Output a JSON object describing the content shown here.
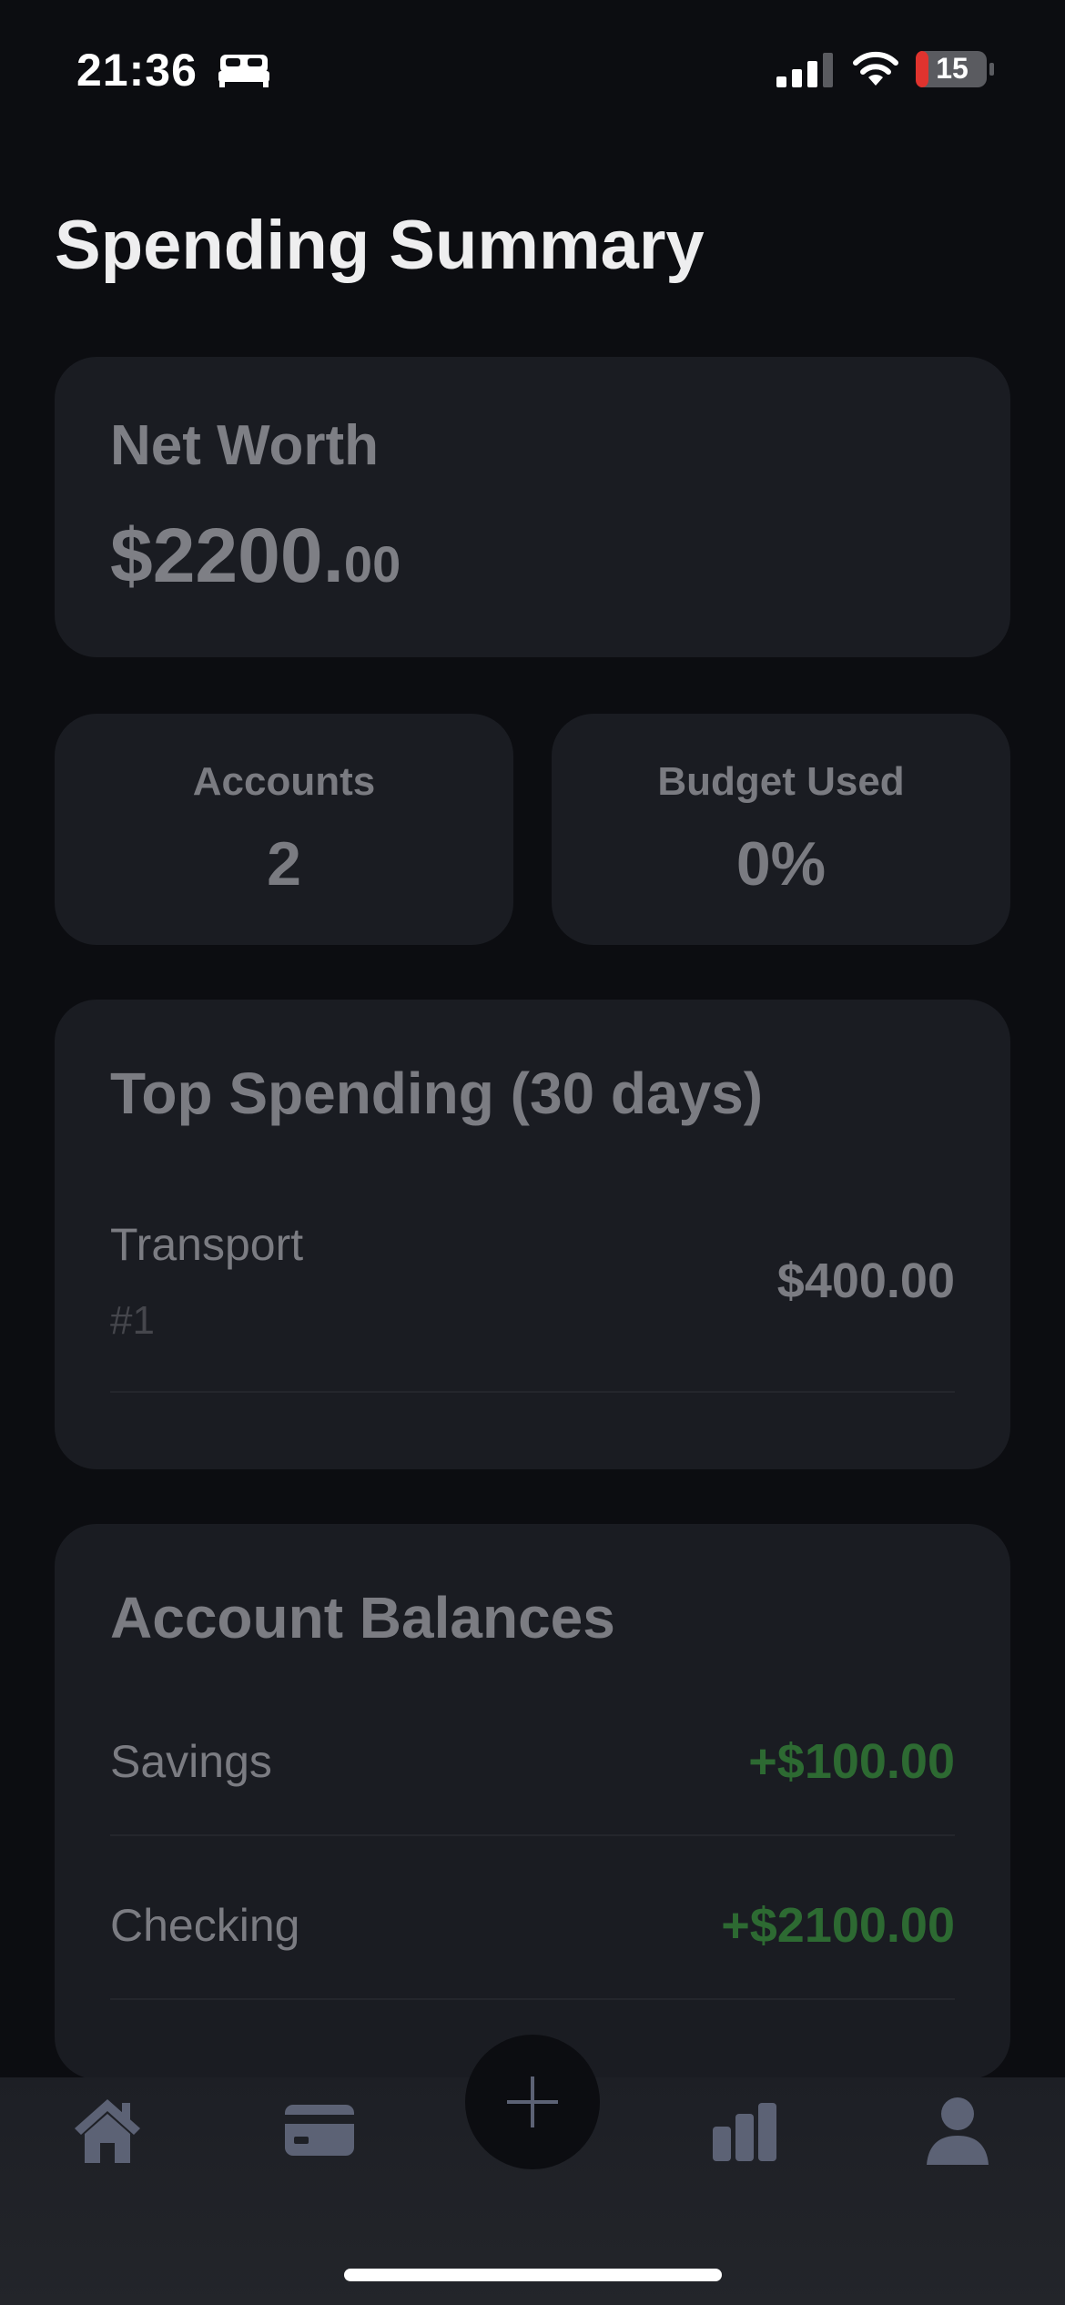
{
  "status_bar": {
    "time": "21:36",
    "battery_level": "15"
  },
  "page": {
    "title": "Spending Summary"
  },
  "net_worth": {
    "label": "Net Worth",
    "value_main": "$2200.",
    "value_cents": "00"
  },
  "stats": {
    "accounts": {
      "label": "Accounts",
      "value": "2"
    },
    "budget_used": {
      "label": "Budget Used",
      "value": "0%"
    }
  },
  "top_spending": {
    "title": "Top Spending (30 days)",
    "items": [
      {
        "category": "Transport",
        "rank": "#1",
        "amount": "$400.00"
      }
    ]
  },
  "account_balances": {
    "title": "Account Balances",
    "items": [
      {
        "name": "Savings",
        "amount": "+$100.00"
      },
      {
        "name": "Checking",
        "amount": "+$2100.00"
      }
    ]
  },
  "tab_bar": {
    "items": [
      "home-icon",
      "credit-card-icon",
      "add-icon",
      "stats-icon",
      "profile-icon"
    ]
  },
  "colors": {
    "background": "#0c0d11",
    "card": "#1a1c22",
    "positive": "#2d6a32",
    "tab_icon": "#5c6275"
  }
}
